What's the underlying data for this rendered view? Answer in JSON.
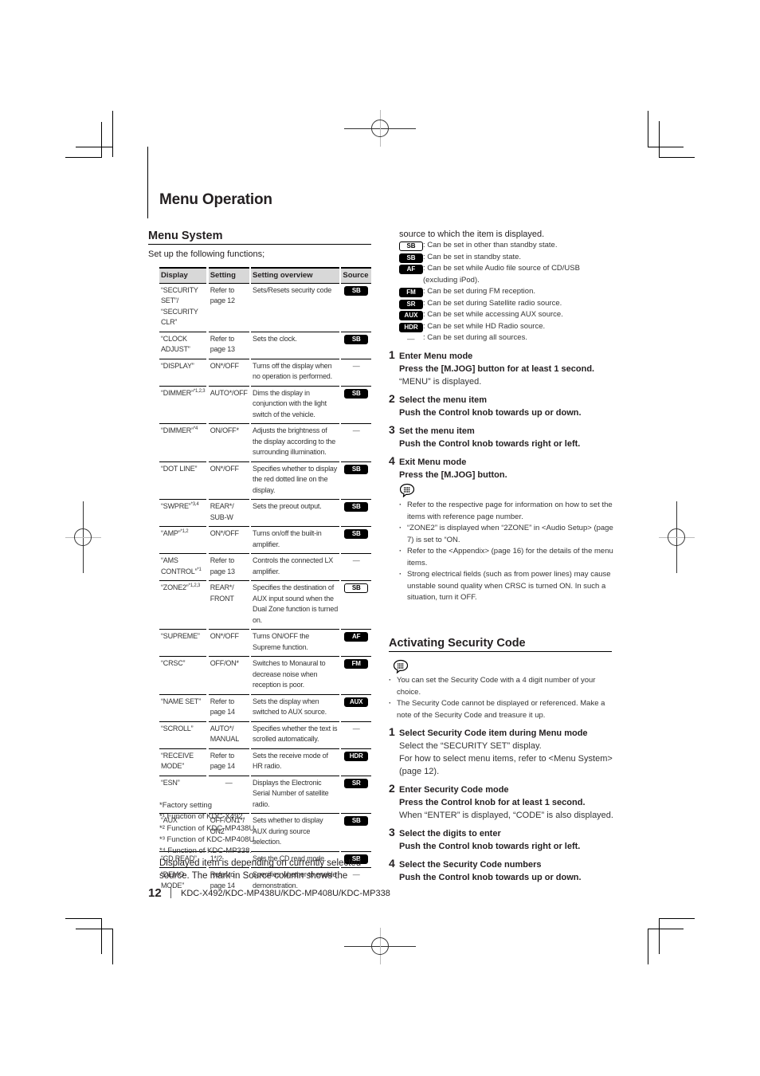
{
  "header": {
    "title": "Menu Operation"
  },
  "menu_system": {
    "heading": "Menu System",
    "intro": "Set up the following functions;",
    "table": {
      "columns": [
        "Display",
        "Setting",
        "Setting overview",
        "Source"
      ],
      "rows": [
        {
          "display": "“SECURITY SET”/ “SECURITY CLR”",
          "sup": "",
          "setting": "Refer to page 12",
          "overview": "Sets/Resets security code",
          "source": "SB",
          "source_style": "filled"
        },
        {
          "display": "“CLOCK ADJUST”",
          "sup": "",
          "setting": "Refer to page 13",
          "overview": "Sets the clock.",
          "source": "SB",
          "source_style": "filled"
        },
        {
          "display": "“DISPLAY”",
          "sup": "",
          "setting": "ON*/OFF",
          "overview": "Turns off the display when no operation is performed.",
          "source": "—",
          "source_style": "dash"
        },
        {
          "display": "“DIMMER”",
          "sup": "*1,2,3",
          "setting": "AUTO*/OFF",
          "overview": "Dims the display in conjunction with the light switch of the vehicle.",
          "source": "SB",
          "source_style": "filled"
        },
        {
          "display": "“DIMMER”",
          "sup": "*4",
          "setting": "ON/OFF*",
          "overview": "Adjusts the brightness of the display according to the surrounding illumination.",
          "source": "—",
          "source_style": "dash"
        },
        {
          "display": "“DOT LINE”",
          "sup": "",
          "setting": "ON*/OFF",
          "overview": "Specifies whether to display the red dotted line on the display.",
          "source": "SB",
          "source_style": "filled"
        },
        {
          "display": "“SWPRE”",
          "sup": "*3,4",
          "setting": "REAR*/ SUB-W",
          "overview": "Sets the preout output.",
          "source": "SB",
          "source_style": "filled"
        },
        {
          "display": "“AMP”",
          "sup": "*1,2",
          "setting": "ON*/OFF",
          "overview": "Turns on/off the built-in amplifier.",
          "source": "SB",
          "source_style": "filled"
        },
        {
          "display": "“AMS CONTROL”",
          "sup": "*1",
          "setting": "Refer to page 13",
          "overview": "Controls the connected LX amplifier.",
          "source": "—",
          "source_style": "dash"
        },
        {
          "display": "“ZONE2”",
          "sup": "*1,2,3",
          "setting": "REAR*/ FRONT",
          "overview": "Specifies the destination of AUX input sound when the Dual Zone function is turned on.",
          "source": "SB",
          "source_style": "outline"
        },
        {
          "display": "“SUPREME”",
          "sup": "",
          "setting": "ON*/OFF",
          "overview": "Turns ON/OFF the Supreme function.",
          "source": "AF",
          "source_style": "filled"
        },
        {
          "display": "“CRSC”",
          "sup": "",
          "setting": "OFF/ON*",
          "overview": "Switches to Monaural to decrease noise when reception is poor.",
          "source": "FM",
          "source_style": "filled"
        },
        {
          "display": "“NAME SET”",
          "sup": "",
          "setting": "Refer to page 14",
          "overview": "Sets the display when switched to AUX source.",
          "source": "AUX",
          "source_style": "filled"
        },
        {
          "display": "“SCROLL”",
          "sup": "",
          "setting": "AUTO*/ MANUAL",
          "overview": "Specifies whether the text is scrolled automatically.",
          "source": "—",
          "source_style": "dash"
        },
        {
          "display": "“RECEIVE MODE”",
          "sup": "",
          "setting": "Refer to page 14",
          "overview": "Sets the receive mode of HR radio.",
          "source": "HDR",
          "source_style": "filled"
        },
        {
          "display": "“ESN”",
          "sup": "",
          "setting": "—",
          "overview": "Displays the Electronic Serial Number of satellite radio.",
          "source": "SR",
          "source_style": "filled"
        },
        {
          "display": "“AUX”",
          "sup": "",
          "setting": "OFF/ON1*/ ON2",
          "overview": "Sets whether to display AUX during source selection.",
          "source": "SB",
          "source_style": "filled"
        },
        {
          "display": "“CD READ”",
          "sup": "",
          "setting": "1*/2",
          "overview": "Sets the CD read mode.",
          "source": "SB",
          "source_style": "filled"
        },
        {
          "display": "“DEMO MODE”",
          "sup": "",
          "setting": "Refer to page 14",
          "overview": "Specifies whether to enable demonstration.",
          "source": "—",
          "source_style": "dash"
        }
      ]
    },
    "footnotes": [
      "*Factory setting",
      "*¹ Function of KDC-X492.",
      "*² Function of KDC-MP438U.",
      "*³ Function of KDC-MP408U.",
      "*⁴ Function of KDC-MP338."
    ],
    "source_note_1": "Displayed item is depending on currently selected",
    "source_note_2": "source. The mark in Source column shows the",
    "source_note_3": "source to which the item is displayed."
  },
  "legend": [
    {
      "badge": "SB",
      "style": "outline",
      "text": ": Can be set in other than standby state."
    },
    {
      "badge": "SB",
      "style": "filled",
      "text": ": Can be set in standby state."
    },
    {
      "badge": "AF",
      "style": "filled",
      "text": ": Can be set while Audio file source of CD/USB (excluding iPod)."
    },
    {
      "badge": "FM",
      "style": "filled",
      "text": ": Can be set during FM reception."
    },
    {
      "badge": "SR",
      "style": "filled",
      "text": ": Can be set during Satellite radio  source."
    },
    {
      "badge": "AUX",
      "style": "filled",
      "text": ": Can be set while accessing AUX source."
    },
    {
      "badge": "HDR",
      "style": "filled",
      "text": ": Can be set while HD Radio source."
    },
    {
      "badge": "—",
      "style": "dash",
      "text": ": Can be set during all sources."
    }
  ],
  "menu_steps": [
    {
      "num": "1",
      "title": "Enter Menu mode",
      "bold": "Press the [M.JOG] button for at least 1 second.",
      "note": "“MENU” is displayed."
    },
    {
      "num": "2",
      "title": "Select the menu item",
      "bold": "Push the Control knob towards up or down.",
      "note": ""
    },
    {
      "num": "3",
      "title": "Set the menu item",
      "bold": "Push the Control knob towards right or left.",
      "note": ""
    },
    {
      "num": "4",
      "title": "Exit Menu mode",
      "bold": "Press the [M.JOG] button.",
      "note": ""
    }
  ],
  "menu_notes": [
    "Refer to the respective page for information on how to set the items with reference page number.",
    "“ZONE2” is displayed when “2ZONE” in <Audio Setup> (page 7) is set to “ON.",
    "Refer to the <Appendix> (page 16) for the details of the menu items.",
    "Strong electrical fields (such as from power lines) may cause unstable sound quality when CRSC is turned ON. In such a situation, turn it OFF."
  ],
  "security": {
    "heading": "Activating Security Code",
    "notes": [
      "You can set the Security Code with a 4 digit number of your choice.",
      "The Security Code cannot be displayed or referenced. Make a note of the Security Code and treasure it up."
    ],
    "steps": [
      {
        "num": "1",
        "title": "Select Security Code item during Menu mode",
        "bold": "",
        "note": "Select the “SECURITY SET” display.",
        "note2": "For how to select menu items, refer to <Menu System>(page 12)."
      },
      {
        "num": "2",
        "title": "Enter Security Code mode",
        "bold": "Press the Control knob for at least 1 second.",
        "note": "When “ENTER” is displayed, “CODE” is also displayed.",
        "note2": ""
      },
      {
        "num": "3",
        "title": "Select the digits to enter",
        "bold": "Push the Control knob towards right or left.",
        "note": "",
        "note2": ""
      },
      {
        "num": "4",
        "title": "Select the Security Code numbers",
        "bold": "Push the Control knob towards up or down.",
        "note": "",
        "note2": ""
      }
    ]
  },
  "footer": {
    "page_number": "12",
    "models": "KDC-X492/KDC-MP438U/KDC-MP408U/KDC-MP338"
  }
}
